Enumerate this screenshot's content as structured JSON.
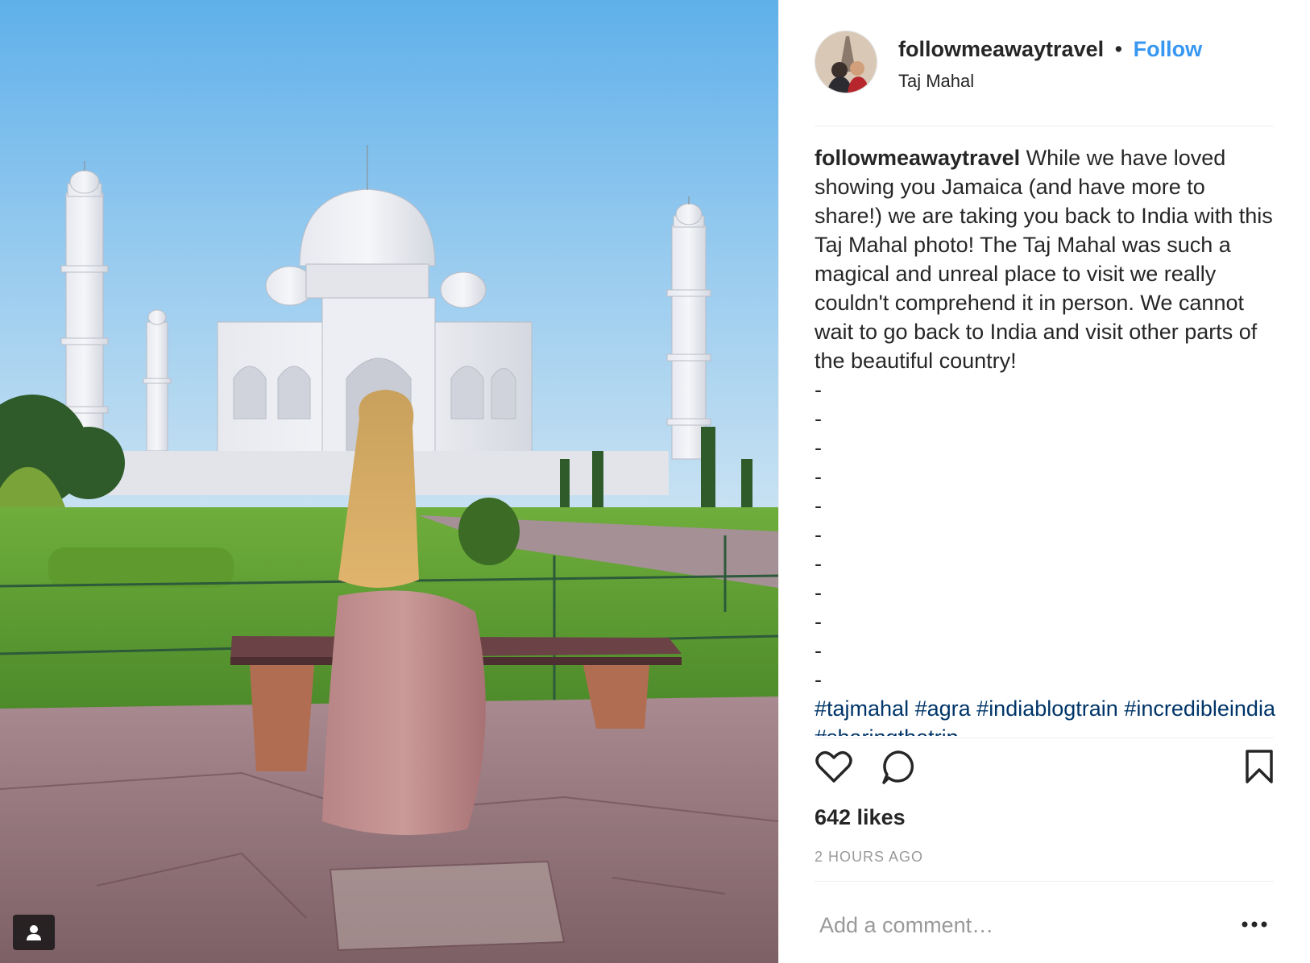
{
  "post": {
    "username": "followmeawaytravel",
    "separator": "•",
    "follow_label": "Follow",
    "location": "Taj Mahal",
    "caption_author": "followmeawaytravel",
    "caption_text": "While we have loved showing you Jamaica (and have more to share!) we are taking you back to India with this Taj Mahal photo! The Taj Mahal was such a magical and unreal place to visit we really couldn't comprehend it in person. We cannot wait to go back to India and visit other parts of the beautiful country!",
    "caption_dashes": [
      "-",
      "-",
      "-",
      "-",
      "-",
      "-",
      "-",
      "-",
      "-",
      "-",
      "-"
    ],
    "hashtags": [
      "#tajmahal",
      "#agra",
      "#indiablogtrain",
      "#incredibleindia",
      "#sharingthetrip"
    ],
    "likes": "642 likes",
    "timestamp": "2 HOURS AGO",
    "comment_placeholder": "Add a comment…"
  },
  "icons": {
    "like": "heart-icon",
    "comment": "speech-bubble-icon",
    "save": "bookmark-icon",
    "more": "ellipsis-icon",
    "tagged_users": "user-tag-icon"
  },
  "colors": {
    "link_blue": "#3897f0",
    "hashtag_navy": "#003569",
    "text": "#262626",
    "muted": "#999999",
    "divider": "#efefef"
  }
}
